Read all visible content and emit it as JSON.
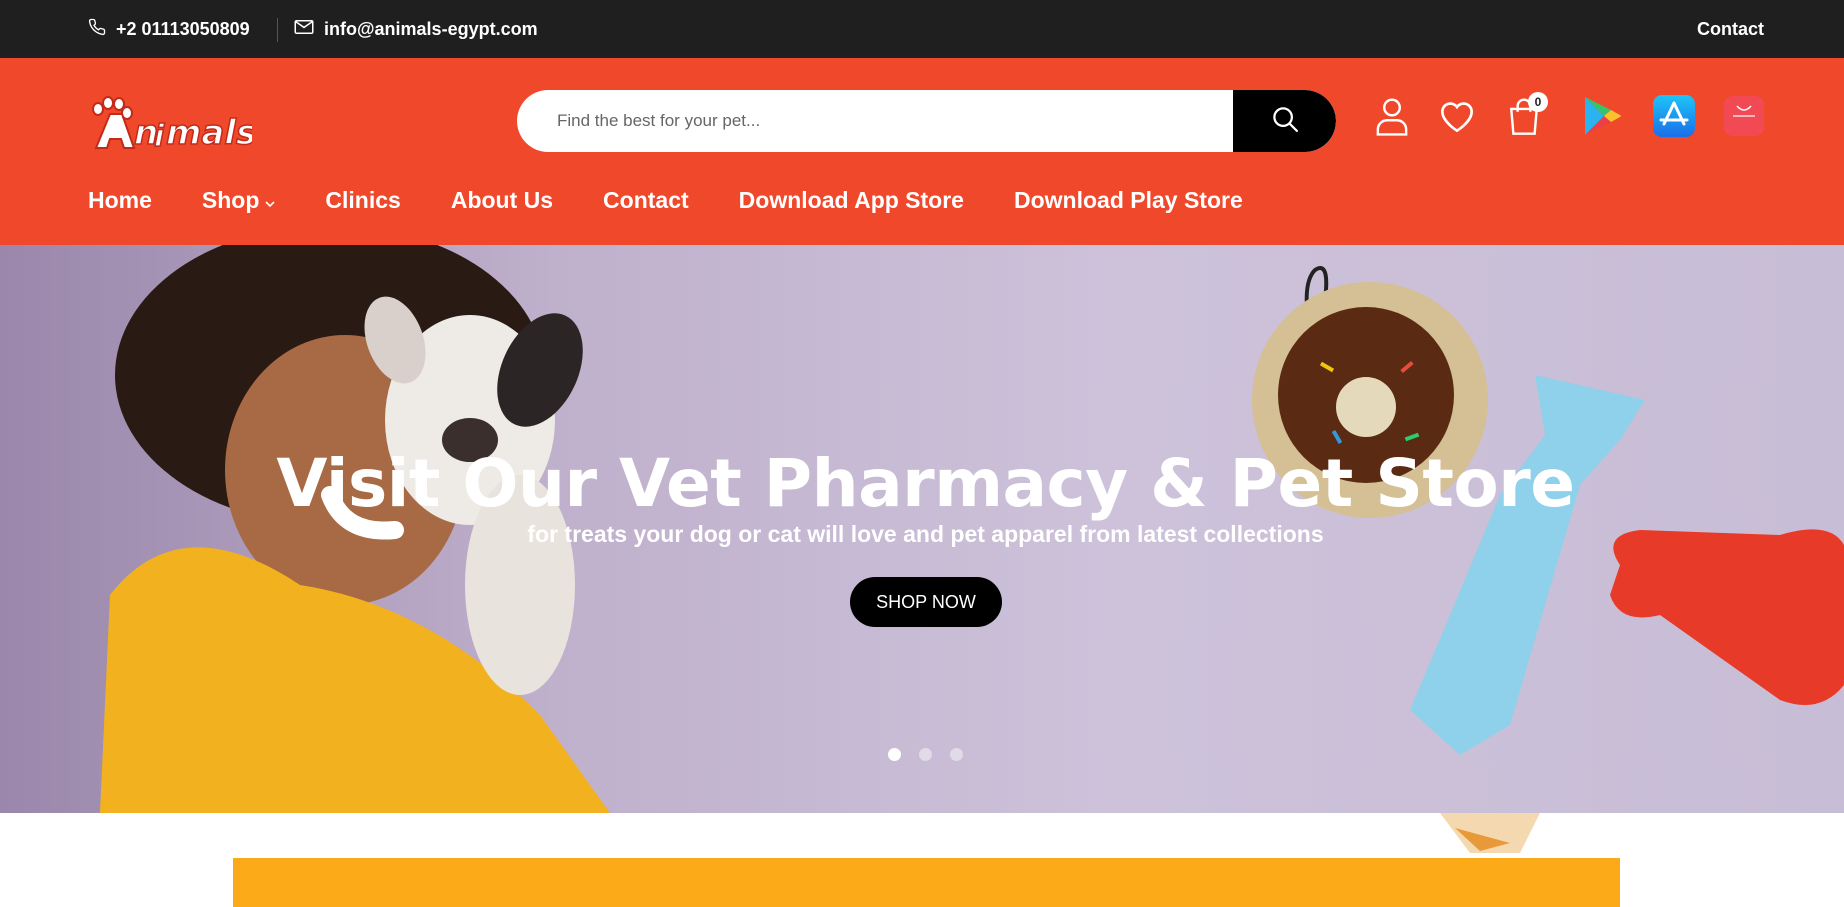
{
  "topbar": {
    "phone": "+2 01113050809",
    "email": "info@animals-egypt.com",
    "contact": "Contact"
  },
  "header": {
    "logo_text": "Animals",
    "search_placeholder": "Find the best for your pet...",
    "cart_count": "0",
    "icons": [
      "user-icon",
      "heart-icon",
      "shopping-bag-icon",
      "google-play-icon",
      "app-store-icon",
      "huawei-appgallery-icon"
    ]
  },
  "nav": {
    "items": [
      {
        "label": "Home"
      },
      {
        "label": "Shop"
      },
      {
        "label": "Clinics"
      },
      {
        "label": "About Us"
      },
      {
        "label": "Contact"
      },
      {
        "label": "Download App Store"
      },
      {
        "label": "Download Play Store"
      }
    ]
  },
  "hero": {
    "title": "Visit Our Vet Pharmacy & Pet Store",
    "subtitle": "for treats your dog or cat will love and pet apparel from latest collections",
    "button": "SHOP NOW",
    "slides": 3,
    "active_slide": 1
  },
  "colors": {
    "topbar": "#1f1f1f",
    "header": "#f0482a",
    "promo": "#fdaa18",
    "button": "#000000"
  }
}
